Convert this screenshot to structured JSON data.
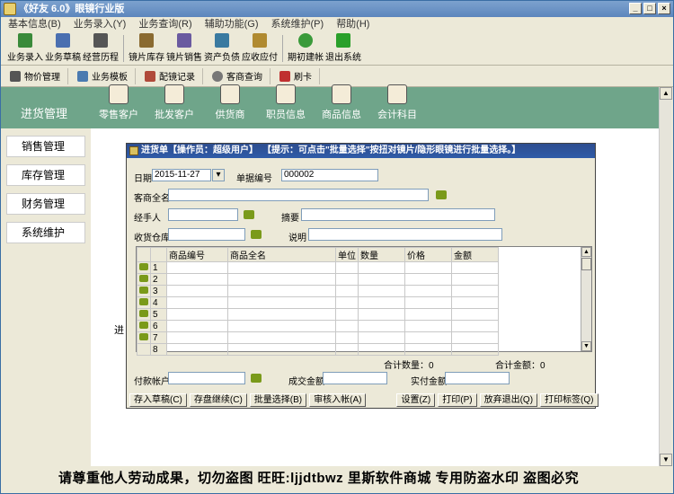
{
  "window": {
    "title": "《好友 6.0》眼镜行业版",
    "min": "_",
    "max": "□",
    "close": "×"
  },
  "menu": [
    "基本信息(B)",
    "业务录入(Y)",
    "业务查询(R)",
    "辅助功能(G)",
    "系统维护(P)",
    "帮助(H)"
  ],
  "toolbar": [
    {
      "label": "业务录入",
      "icon": "entry-icon"
    },
    {
      "label": "业务草稿",
      "icon": "draft-icon"
    },
    {
      "label": "经营历程",
      "icon": "history-icon"
    },
    {
      "label": "镜片库存",
      "icon": "lens-stock-icon"
    },
    {
      "label": "镜片销售",
      "icon": "lens-sales-icon"
    },
    {
      "label": "资产负债",
      "icon": "balance-icon"
    },
    {
      "label": "应收应付",
      "icon": "receivable-icon"
    },
    {
      "label": "期初建帐",
      "icon": "opening-icon"
    },
    {
      "label": "退出系统",
      "icon": "exit-icon"
    }
  ],
  "toolbar2": [
    {
      "label": "物价管理",
      "icon": "price-icon"
    },
    {
      "label": "业务模板",
      "icon": "template-icon"
    },
    {
      "label": "配镜记录",
      "icon": "glasses-icon"
    },
    {
      "label": "客商查询",
      "icon": "query-icon"
    },
    {
      "label": "刷卡",
      "icon": "check-icon"
    }
  ],
  "sidebar": {
    "active": "进货管理",
    "items": [
      "销售管理",
      "库存管理",
      "财务管理",
      "系统维护"
    ]
  },
  "modules": [
    "零售客户",
    "批发客户",
    "供货商",
    "职员信息",
    "商品信息",
    "会计科目"
  ],
  "content_label": "进",
  "dialog": {
    "title": "进货单【操作员：超级用户】",
    "hint": "【提示：可点击\"批量选择\"按扭对镜片/隐形眼镜进行批量选择。】",
    "date_label": "日期",
    "date_value": "2015-11-27",
    "docno_label": "单据编号",
    "docno_value": "000002",
    "vendor_label": "客商全名",
    "handler_label": "经手人",
    "summary_label": "摘要",
    "warehouse_label": "收货仓库",
    "note_label": "说明",
    "columns": [
      "商品编号",
      "商品全名",
      "单位",
      "数量",
      "价格",
      "金额"
    ],
    "rows": [
      "1",
      "2",
      "3",
      "4",
      "5",
      "6",
      "7",
      "8"
    ],
    "total_qty": "合计数量：0",
    "total_amt": "合计金额：0",
    "pay_label": "付款帐户",
    "deal_label": "成交金额",
    "paid_label": "实付金额",
    "buttons": [
      "存入草稿(C)",
      "存盘继续(C)",
      "批量选择(B)",
      "审核入帐(A)",
      "设置(Z)",
      "打印(P)",
      "放弃退出(Q)",
      "打印标签(Q)"
    ]
  },
  "watermark": "请尊重他人劳动成果，切勿盗图 旺旺:ljjdtbwz 里斯软件商城 专用防盗水印 盗图必究"
}
